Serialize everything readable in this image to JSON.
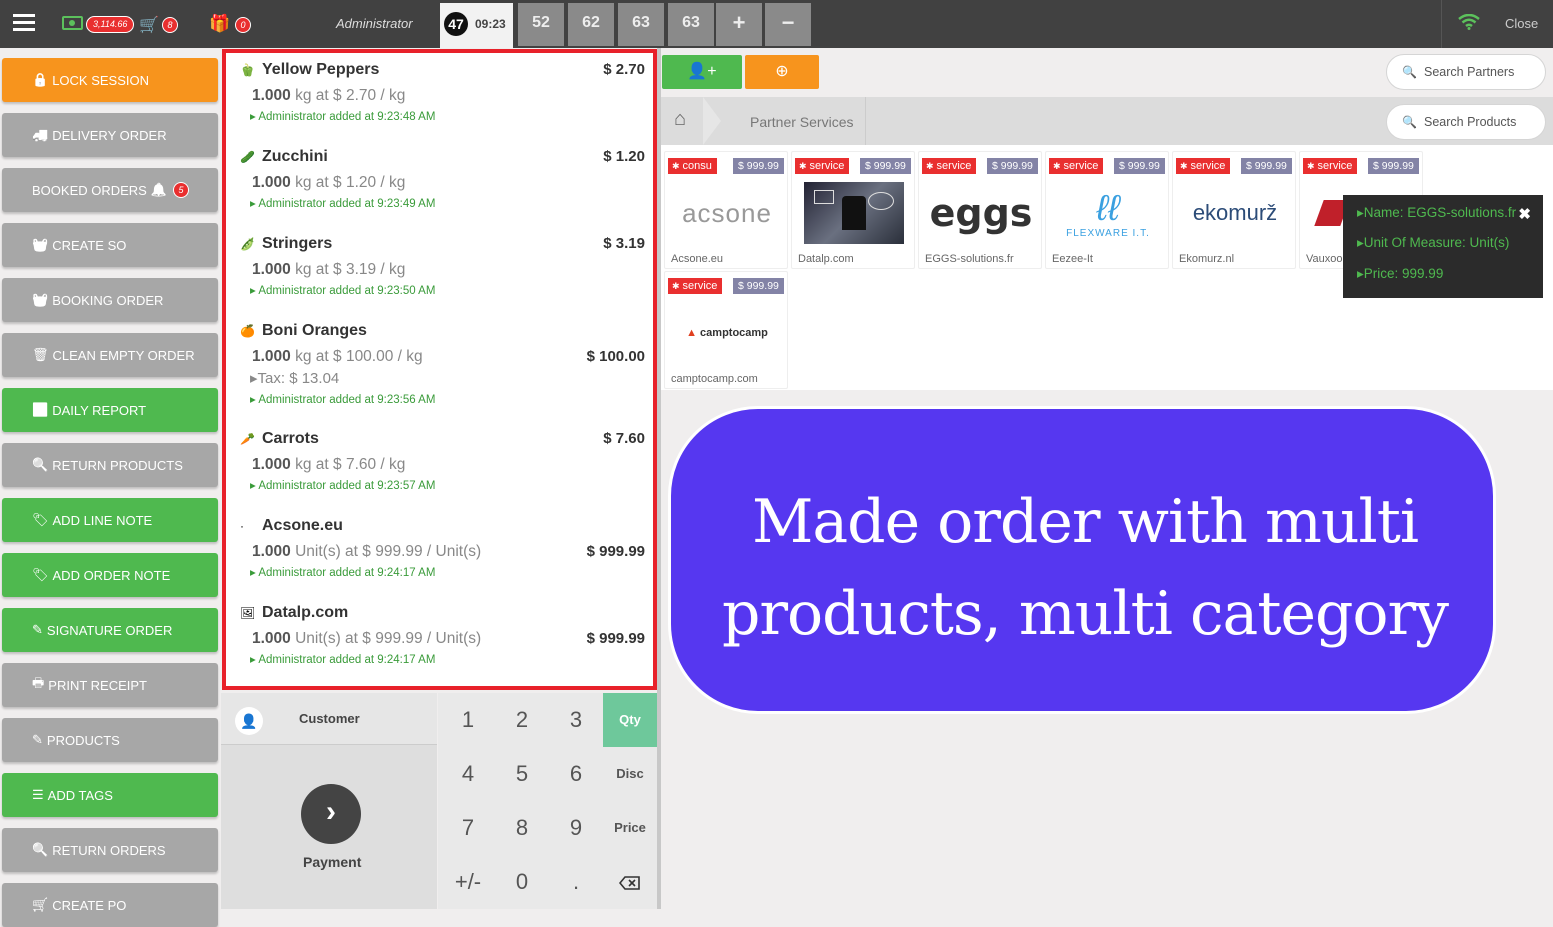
{
  "topbar": {
    "cash_total": "3,114.66",
    "cart_count": "8",
    "gift_count": "0",
    "user": "Administrator",
    "active_order": {
      "number": "47",
      "time": "09:23"
    },
    "orders": [
      "52",
      "62",
      "63",
      "63"
    ],
    "add_label": "+",
    "remove_label": "−",
    "close_label": "Close"
  },
  "left_buttons": [
    {
      "label": "LOCK SESSION",
      "icon": "lock-icon",
      "color": "#f7941d"
    },
    {
      "label": "DELIVERY ORDER",
      "icon": "truck-icon",
      "color": "#a7a7a7"
    },
    {
      "label": "BOOKED ORDERS",
      "icon": "bell-icon",
      "badge": "5",
      "color": "#a7a7a7"
    },
    {
      "label": "CREATE SO",
      "icon": "basket-icon",
      "color": "#a7a7a7"
    },
    {
      "label": "BOOKING ORDER",
      "icon": "basket-icon",
      "color": "#a7a7a7"
    },
    {
      "label": "CLEAN EMPTY ORDER",
      "icon": "trash-icon",
      "color": "#a7a7a7"
    },
    {
      "label": "DAILY REPORT",
      "icon": "signal-icon",
      "color": "#4fb94f"
    },
    {
      "label": "RETURN PRODUCTS",
      "icon": "search-icon",
      "color": "#a7a7a7"
    },
    {
      "label": "ADD LINE NOTE",
      "icon": "tag-icon",
      "color": "#4fb94f"
    },
    {
      "label": "ADD ORDER NOTE",
      "icon": "tag-icon",
      "color": "#4fb94f"
    },
    {
      "label": "SIGNATURE ORDER",
      "icon": "edit-icon",
      "color": "#4fb94f"
    },
    {
      "label": "PRINT RECEIPT",
      "icon": "printer-icon",
      "color": "#a7a7a7"
    },
    {
      "label": "PRODUCTS",
      "icon": "edit-icon",
      "color": "#a7a7a7"
    },
    {
      "label": "ADD TAGS",
      "icon": "sliders-icon",
      "color": "#4fb94f"
    },
    {
      "label": "RETURN ORDERS",
      "icon": "search-icon",
      "color": "#a7a7a7"
    },
    {
      "label": "CREATE PO",
      "icon": "cart-icon",
      "color": "#a7a7a7"
    }
  ],
  "order_lines": [
    {
      "name": "Yellow Peppers",
      "price": "$ 2.70",
      "qty": "1.000",
      "detail": "kg at $ 2.70 / kg",
      "note": "Administrator added at 9:23:48 AM"
    },
    {
      "name": "Zucchini",
      "price": "$ 1.20",
      "qty": "1.000",
      "detail": "kg at $ 1.20 / kg",
      "note": "Administrator added at 9:23:49 AM"
    },
    {
      "name": "Stringers",
      "price": "$ 3.19",
      "qty": "1.000",
      "detail": "kg at $ 3.19 / kg",
      "note": "Administrator added at 9:23:50 AM"
    },
    {
      "name": "Boni Oranges",
      "price": "$ 100.00",
      "qty": "1.000",
      "detail": "kg at $ 100.00 / kg",
      "tax": "Tax: $ 13.04",
      "note": "Administrator added at 9:23:56 AM"
    },
    {
      "name": "Carrots",
      "price": "$ 7.60",
      "qty": "1.000",
      "detail": "kg at $ 7.60 / kg",
      "note": "Administrator added at 9:23:57 AM"
    },
    {
      "name": "Acsone.eu",
      "price": "$ 999.99",
      "qty": "1.000",
      "detail": "Unit(s) at $ 999.99 / Unit(s)",
      "note": "Administrator added at 9:24:17 AM"
    },
    {
      "name": "Datalp.com",
      "price": "$ 999.99",
      "qty": "1.000",
      "detail": "Unit(s) at $ 999.99 / Unit(s)",
      "note": "Administrator added at 9:24:17 AM"
    }
  ],
  "customer": {
    "label": "Customer"
  },
  "payment": {
    "label": "Payment"
  },
  "numpad": {
    "keys": [
      "1",
      "2",
      "3",
      "4",
      "5",
      "6",
      "7",
      "8",
      "9",
      "+/-",
      "0",
      "."
    ],
    "modes": [
      "Qty",
      "Disc",
      "Price"
    ],
    "active_mode": "Qty"
  },
  "search_partners": "Search Partners",
  "search_products": "Search Products",
  "breadcrumb": {
    "category": "Partner Services"
  },
  "products": [
    {
      "name": "Acsone.eu",
      "type": "consu",
      "price": "$ 999.99",
      "logo": "acsone"
    },
    {
      "name": "Datalp.com",
      "type": "service",
      "price": "$ 999.99",
      "logo": ""
    },
    {
      "name": "EGGS-solutions.fr",
      "type": "service",
      "price": "$ 999.99",
      "logo": "eggs"
    },
    {
      "name": "Eezee-It",
      "type": "service",
      "price": "$ 999.99",
      "logo": "FLEXWARE I.T."
    },
    {
      "name": "Ekomurz.nl",
      "type": "service",
      "price": "$ 999.99",
      "logo": "ekomurž"
    },
    {
      "name": "Vauxoo.com",
      "type": "service",
      "price": "$ 999.99",
      "logo": "VAUXOO"
    },
    {
      "name": "camptocamp.com",
      "type": "service",
      "price": "$ 999.99",
      "logo": "camptocamp"
    }
  ],
  "tooltip": {
    "name": "Name: EGGS-solutions.fr",
    "uom": "Unit Of Measure: Unit(s)",
    "price": "Price: 999.99"
  },
  "banner": {
    "line1": "Made order with multi",
    "line2": "products, multi category",
    "color": "#5637f0"
  }
}
